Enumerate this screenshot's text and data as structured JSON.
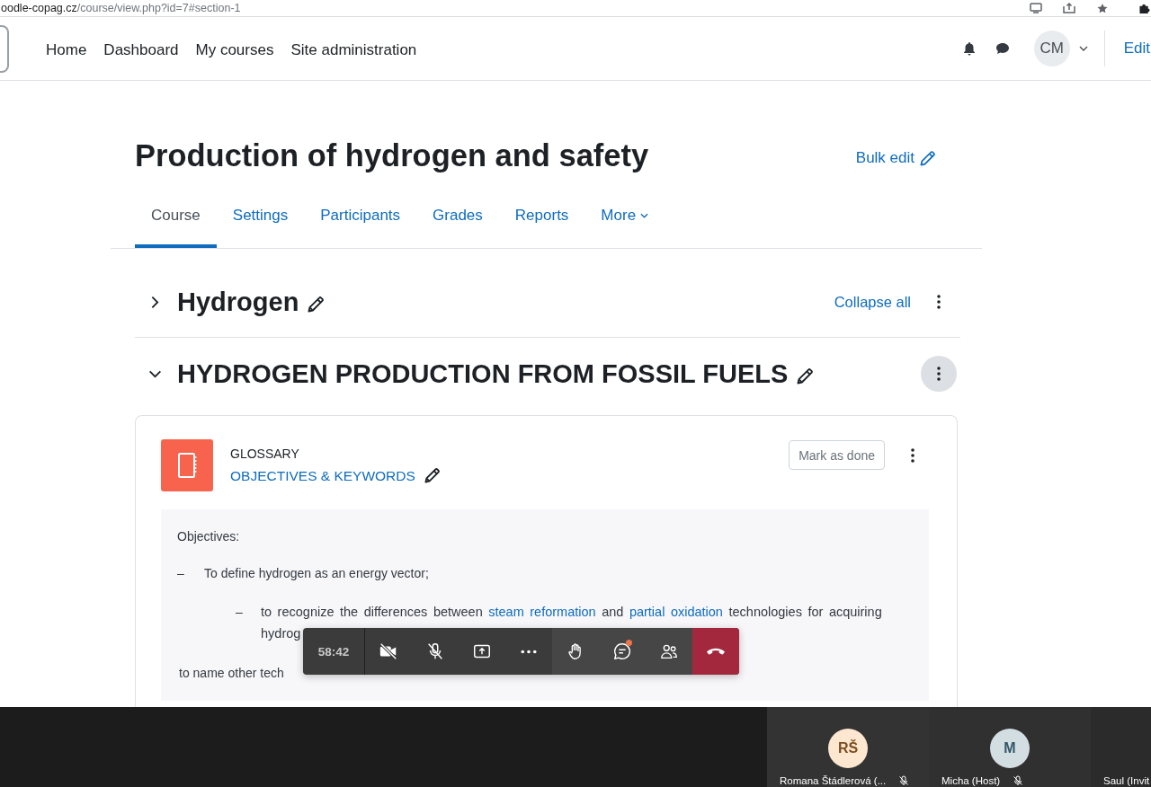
{
  "browser": {
    "url_host": "oodle-copag.cz",
    "url_path": "/course/view.php?id=7#section-1"
  },
  "navbar": {
    "items": [
      "Home",
      "Dashboard",
      "My courses",
      "Site administration"
    ],
    "user_initials": "CM",
    "edit_label": "Edit"
  },
  "course": {
    "title": "Production of hydrogen and safety",
    "bulk_edit": "Bulk edit",
    "collapse_all": "Collapse all",
    "tabs": [
      {
        "label": "Course",
        "selected": true,
        "kind": "link"
      },
      {
        "label": "Settings",
        "selected": false,
        "kind": "link"
      },
      {
        "label": "Participants",
        "selected": false,
        "kind": "link"
      },
      {
        "label": "Grades",
        "selected": false,
        "kind": "link"
      },
      {
        "label": "Reports",
        "selected": false,
        "kind": "link"
      },
      {
        "label": "More",
        "selected": false,
        "kind": "menu"
      }
    ]
  },
  "sections": [
    {
      "title": "Hydrogen",
      "expanded": false,
      "menu_highlighted": false
    },
    {
      "title": "HYDROGEN PRODUCTION FROM FOSSIL FUELS",
      "expanded": true,
      "menu_highlighted": true,
      "activities": [
        {
          "type_label": "GLOSSARY",
          "name": "OBJECTIVES & KEYWORDS",
          "mark_done": "Mark as done",
          "description": {
            "heading": "Objectives:",
            "items": [
              {
                "marker": "–",
                "text": "To define hydrogen as an energy vector;",
                "children": [
                  {
                    "marker": "–",
                    "segments": [
                      {
                        "kind": "text",
                        "text": "to recognize the differences between "
                      },
                      {
                        "kind": "link",
                        "text": "steam reformation"
                      },
                      {
                        "kind": "text",
                        "text": " and "
                      },
                      {
                        "kind": "link",
                        "text": "partial oxidation"
                      },
                      {
                        "kind": "text",
                        "text": " technologies for acquiring hydrog"
                      }
                    ]
                  }
                ]
              }
            ],
            "closing": "to name other tech"
          }
        }
      ]
    }
  ],
  "meeting": {
    "timer": "58:42",
    "buttons": [
      {
        "kind": "camera",
        "off": true
      },
      {
        "kind": "mic",
        "off": true
      },
      {
        "kind": "share"
      },
      {
        "kind": "more"
      },
      {
        "kind": "raise-hand"
      },
      {
        "kind": "chat",
        "unread": true
      },
      {
        "kind": "people"
      },
      {
        "kind": "leave"
      }
    ]
  },
  "participants": [
    {
      "name": "Romana Štádlerová (...",
      "initials": "RŠ",
      "color": "#fde7d1",
      "muted": true
    },
    {
      "name": "Micha (Host)",
      "initials": "M",
      "color": "#d3dee3",
      "muted": true
    },
    {
      "name": "Saul (Invit"
    }
  ]
}
